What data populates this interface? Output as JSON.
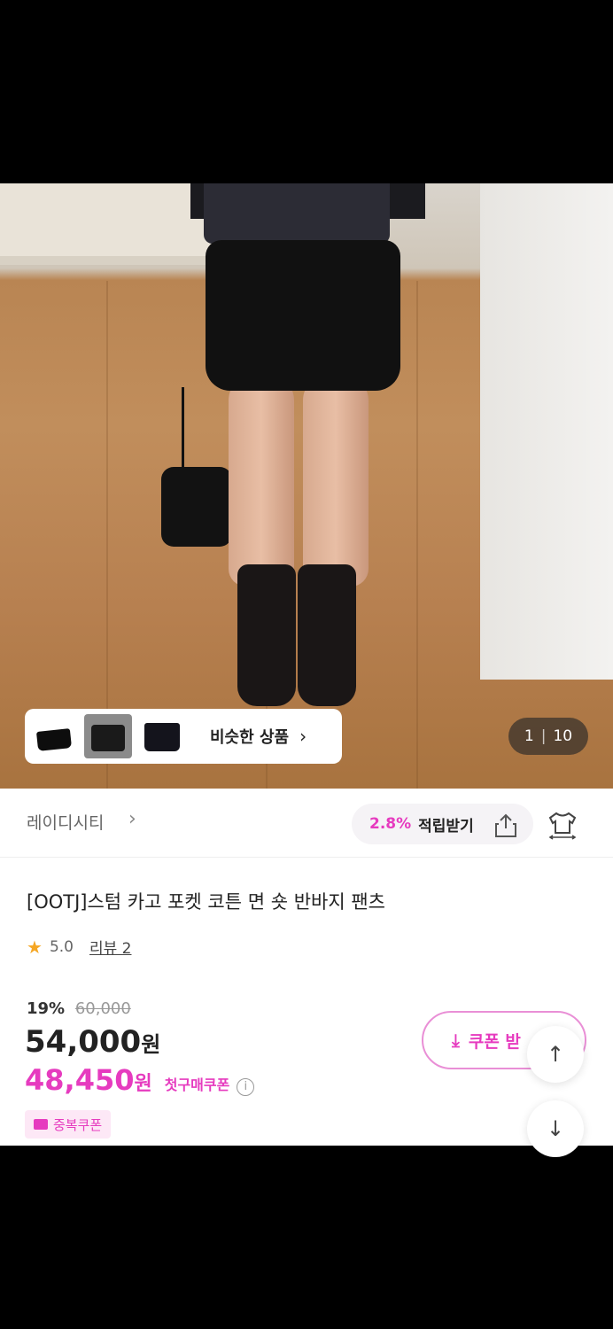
{
  "similar": {
    "label": "비슷한 상품",
    "chevron": "›"
  },
  "image_counter": {
    "current": "1",
    "separator": "|",
    "total": "10"
  },
  "store": {
    "name": "레이디시티",
    "chevron": "›"
  },
  "points": {
    "rate": "2.8%",
    "label": "적립받기"
  },
  "product": {
    "title": "[OOTJ]스텀 카고 포켓 코튼 면 숏 반바지 팬츠",
    "rating": "5.0",
    "review_label": "리뷰 2",
    "discount_pct": "19%",
    "original_price": "60,000",
    "price": "54,000",
    "price_unit": "원",
    "coupon_price": "48,450",
    "coupon_unit": "원",
    "coupon_note": "첫구매쿠폰",
    "dup_badge": "중복쿠폰"
  },
  "coupon_button": {
    "label": "쿠폰 받"
  },
  "icons": [
    "share-icon",
    "tshirt-icon",
    "star-icon",
    "info-icon",
    "download-icon",
    "arrow-up-icon",
    "arrow-down-icon",
    "ticket-icon"
  ],
  "colors": {
    "accent": "#e63bbf",
    "star": "#f5a623"
  }
}
